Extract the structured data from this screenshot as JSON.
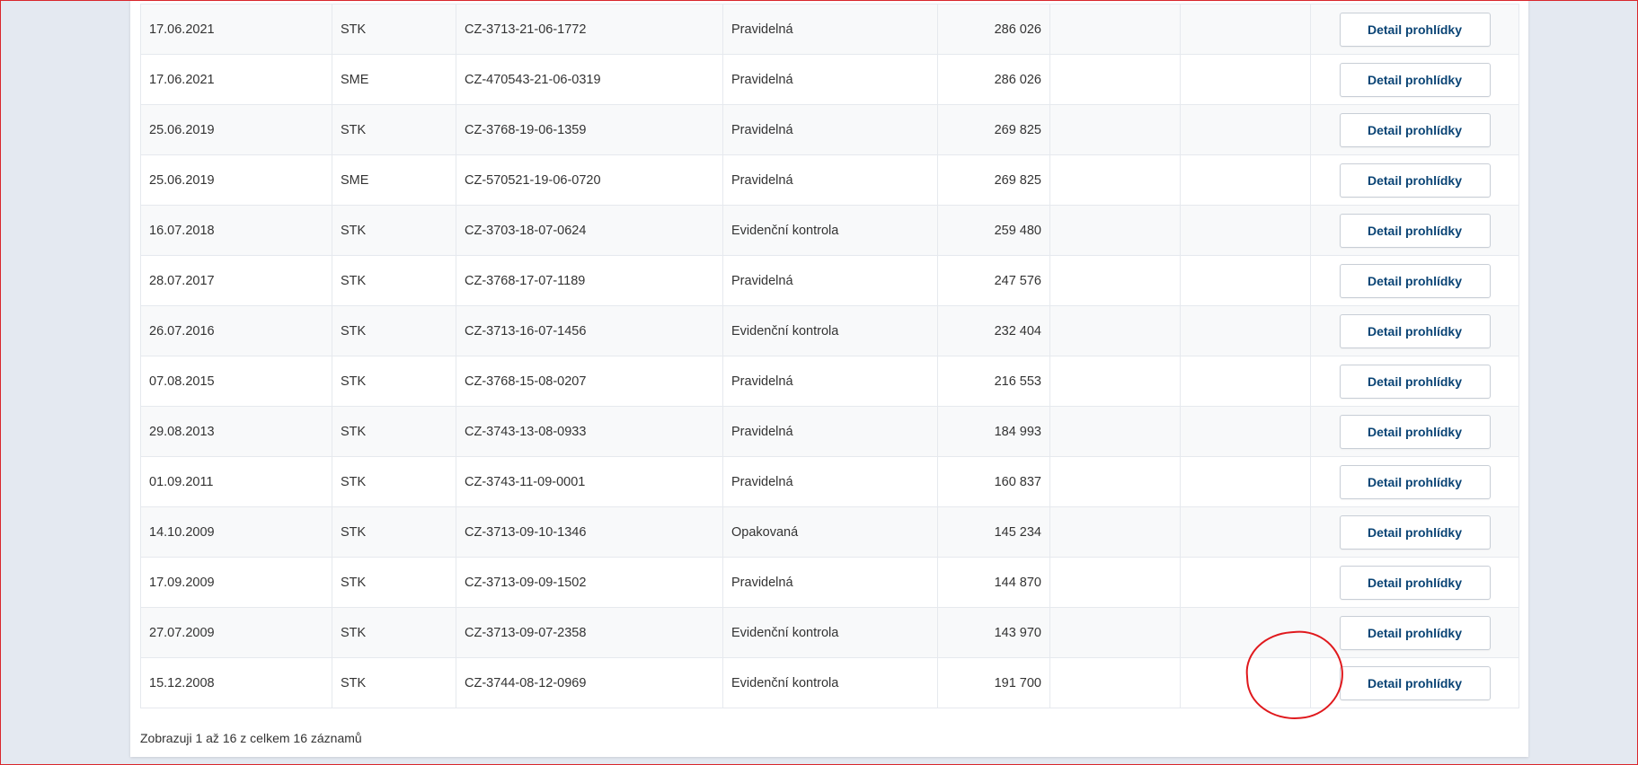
{
  "table": {
    "rows": [
      {
        "date": "17.06.2021",
        "type": "STK",
        "protocol": "CZ-3713-21-06-1772",
        "kind": "Pravidelná",
        "km": "286 026",
        "action": "Detail prohlídky"
      },
      {
        "date": "17.06.2021",
        "type": "SME",
        "protocol": "CZ-470543-21-06-0319",
        "kind": "Pravidelná",
        "km": "286 026",
        "action": "Detail prohlídky"
      },
      {
        "date": "25.06.2019",
        "type": "STK",
        "protocol": "CZ-3768-19-06-1359",
        "kind": "Pravidelná",
        "km": "269 825",
        "action": "Detail prohlídky"
      },
      {
        "date": "25.06.2019",
        "type": "SME",
        "protocol": "CZ-570521-19-06-0720",
        "kind": "Pravidelná",
        "km": "269 825",
        "action": "Detail prohlídky"
      },
      {
        "date": "16.07.2018",
        "type": "STK",
        "protocol": "CZ-3703-18-07-0624",
        "kind": "Evidenční kontrola",
        "km": "259 480",
        "action": "Detail prohlídky"
      },
      {
        "date": "28.07.2017",
        "type": "STK",
        "protocol": "CZ-3768-17-07-1189",
        "kind": "Pravidelná",
        "km": "247 576",
        "action": "Detail prohlídky"
      },
      {
        "date": "26.07.2016",
        "type": "STK",
        "protocol": "CZ-3713-16-07-1456",
        "kind": "Evidenční kontrola",
        "km": "232 404",
        "action": "Detail prohlídky"
      },
      {
        "date": "07.08.2015",
        "type": "STK",
        "protocol": "CZ-3768-15-08-0207",
        "kind": "Pravidelná",
        "km": "216 553",
        "action": "Detail prohlídky"
      },
      {
        "date": "29.08.2013",
        "type": "STK",
        "protocol": "CZ-3743-13-08-0933",
        "kind": "Pravidelná",
        "km": "184 993",
        "action": "Detail prohlídky"
      },
      {
        "date": "01.09.2011",
        "type": "STK",
        "protocol": "CZ-3743-11-09-0001",
        "kind": "Pravidelná",
        "km": "160 837",
        "action": "Detail prohlídky"
      },
      {
        "date": "14.10.2009",
        "type": "STK",
        "protocol": "CZ-3713-09-10-1346",
        "kind": "Opakovaná",
        "km": "145 234",
        "action": "Detail prohlídky"
      },
      {
        "date": "17.09.2009",
        "type": "STK",
        "protocol": "CZ-3713-09-09-1502",
        "kind": "Pravidelná",
        "km": "144 870",
        "action": "Detail prohlídky"
      },
      {
        "date": "27.07.2009",
        "type": "STK",
        "protocol": "CZ-3713-09-07-2358",
        "kind": "Evidenční kontrola",
        "km": "143 970",
        "action": "Detail prohlídky"
      },
      {
        "date": "15.12.2008",
        "type": "STK",
        "protocol": "CZ-3744-08-12-0969",
        "kind": "Evidenční kontrola",
        "km": "191 700",
        "action": "Detail prohlídky"
      }
    ]
  },
  "footer": {
    "info": "Zobrazuji 1 až 16 z celkem 16 záznamů"
  },
  "colors": {
    "accent": "#0a4475",
    "annotation": "#e0191d"
  }
}
